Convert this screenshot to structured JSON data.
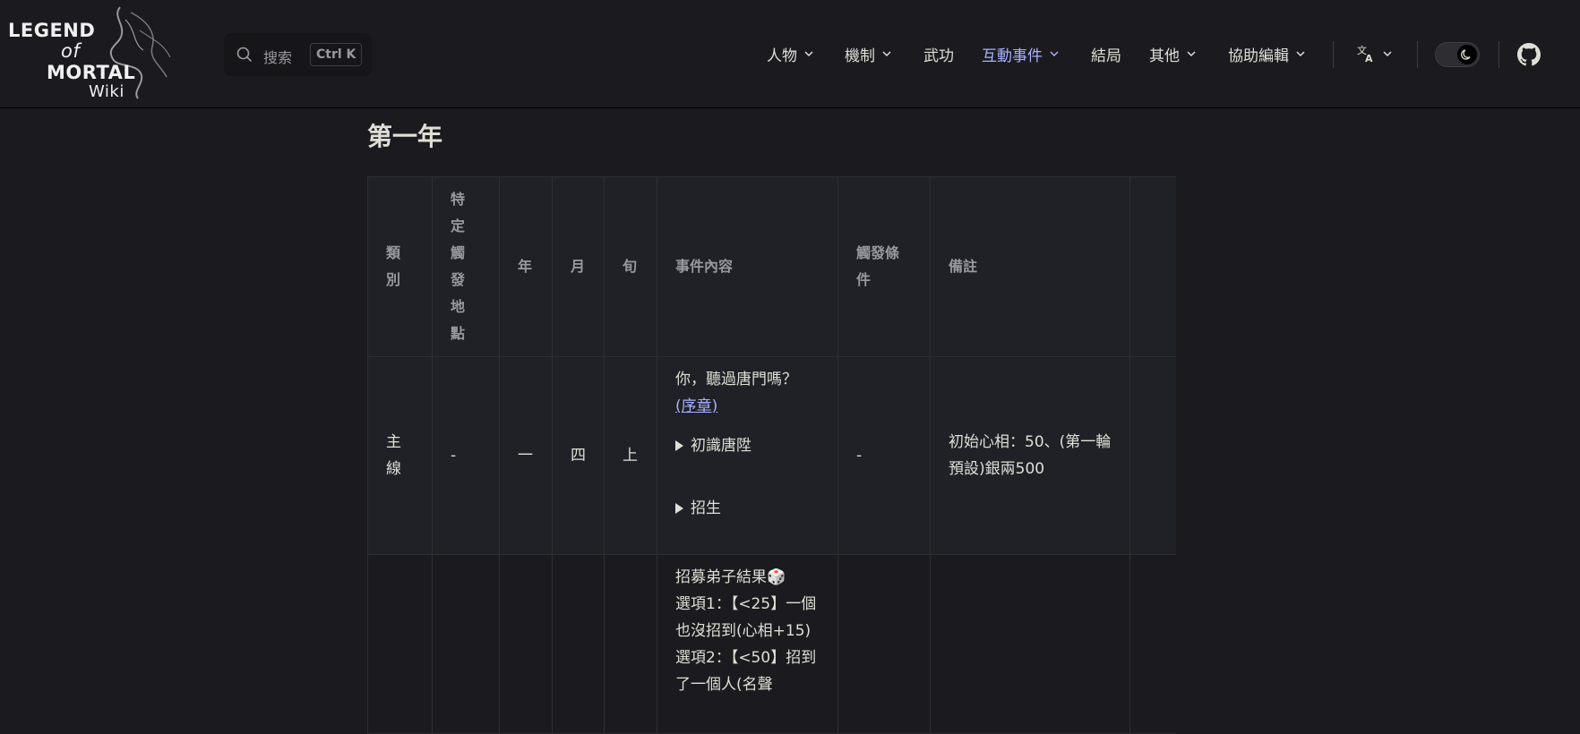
{
  "logo": {
    "line1": "LEGEND",
    "line2": "of",
    "line3": "MORTAL",
    "line4": "Wiki"
  },
  "search": {
    "placeholder": "搜索",
    "kbd": "Ctrl K"
  },
  "nav": {
    "items": [
      {
        "label": "人物",
        "has_dropdown": true
      },
      {
        "label": "機制",
        "has_dropdown": true
      },
      {
        "label": "武功",
        "has_dropdown": false
      },
      {
        "label": "互動事件",
        "has_dropdown": true,
        "active": true
      },
      {
        "label": "結局",
        "has_dropdown": false
      },
      {
        "label": "其他",
        "has_dropdown": true
      },
      {
        "label": "協助編輯",
        "has_dropdown": true
      }
    ],
    "language_icon": "translate-icon",
    "theme_toggle_icon": "moon-icon",
    "github_icon": "github-icon"
  },
  "page": {
    "heading": "第一年"
  },
  "table": {
    "headers": [
      "類別",
      "特定觸發地點",
      "年",
      "月",
      "旬",
      "事件內容",
      "觸發條件",
      "備註"
    ],
    "rows": [
      {
        "category": "主線",
        "location": "-",
        "year": "一",
        "month": "四",
        "xun": "上",
        "event_text": "你，聽過唐門嗎？",
        "event_link": "(序章)",
        "details": [
          "初識唐陞",
          "招生"
        ],
        "condition": "-",
        "note": "初始心相：50、(第一輪預設)銀兩500"
      },
      {
        "category": "",
        "location": "",
        "year": "",
        "month": "",
        "xun": "",
        "event_lines": [
          "招募弟子結果🎲",
          "選項1：【<25】一個也沒招到(心相+15)",
          "選項2：【<50】招到了一個人(名聲"
        ],
        "condition": "",
        "note": ""
      }
    ]
  },
  "colors": {
    "background": "#1b1b1f",
    "accent": "#a8b1ff",
    "header_bg": "#202127",
    "border": "#2e2e32"
  }
}
